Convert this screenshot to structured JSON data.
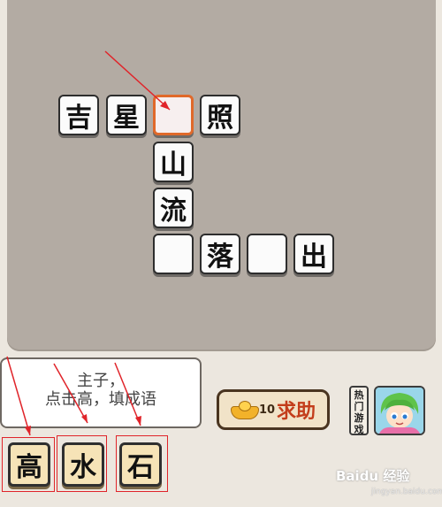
{
  "board": {
    "row_top": [
      "吉",
      "星",
      "",
      "照"
    ],
    "column": [
      "山",
      "流"
    ],
    "row_bottom": [
      "",
      "落",
      "",
      "出"
    ]
  },
  "prompt": {
    "line1": "主子，",
    "line2": "点击高，填成语"
  },
  "help_button": {
    "count": "10",
    "label": "求助"
  },
  "hot_games": {
    "label_chars": [
      "热",
      "门",
      "游",
      "戏"
    ]
  },
  "choices": [
    "高",
    "水",
    "石"
  ],
  "watermark": {
    "text": "Baidu 经验",
    "sub": "jingyan.baidu.com"
  },
  "colors": {
    "board": "#b3aba3",
    "selected_border": "#e0692a",
    "annotation": "#e0242a",
    "help_text": "#c33d1b"
  }
}
